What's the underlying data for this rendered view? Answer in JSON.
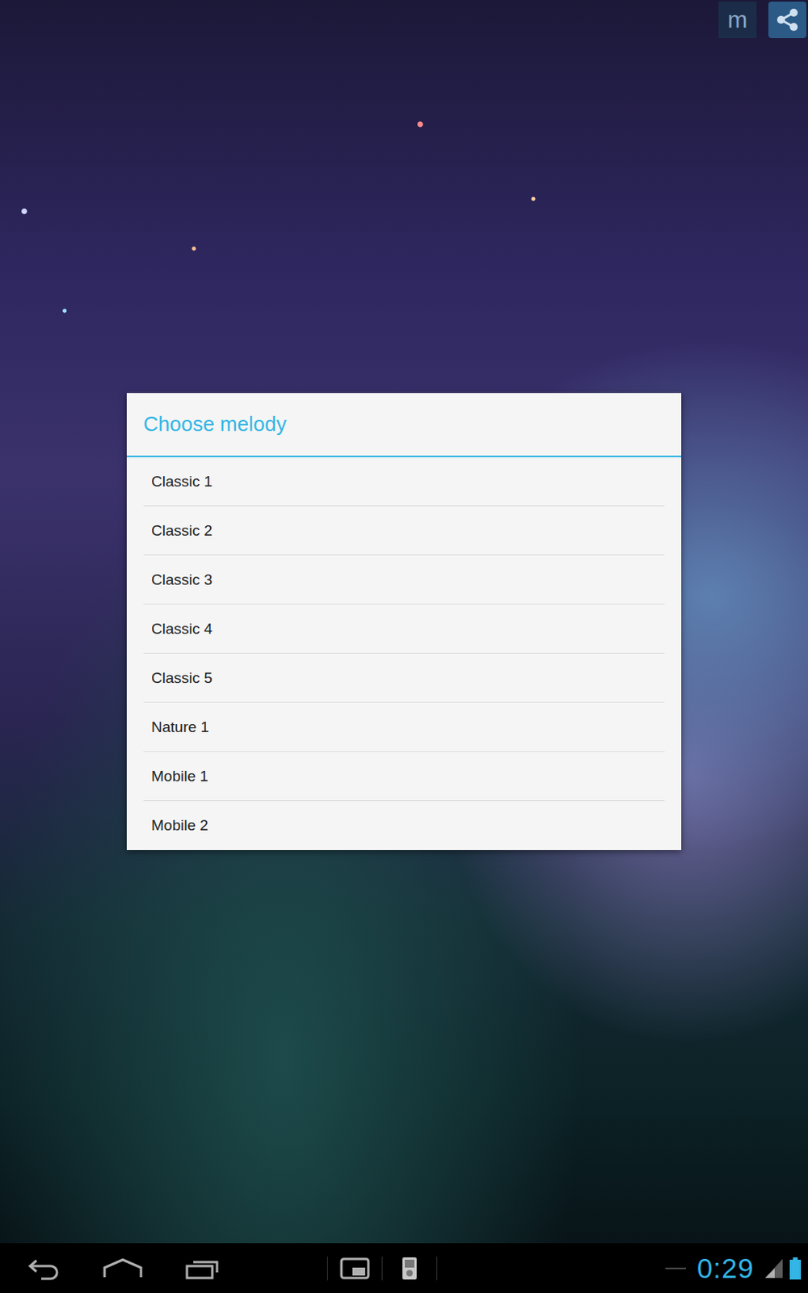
{
  "top_actions": {
    "menu_label": "m"
  },
  "dialog": {
    "title": "Choose melody",
    "items": [
      {
        "label": "Classic 1",
        "selected": false
      },
      {
        "label": "Classic 2",
        "selected": false
      },
      {
        "label": "Classic 3",
        "selected": false
      },
      {
        "label": "Classic 4",
        "selected": false
      },
      {
        "label": "Classic 5",
        "selected": false
      },
      {
        "label": "Nature 1",
        "selected": false
      },
      {
        "label": "Mobile 1",
        "selected": false
      },
      {
        "label": "Mobile 2",
        "selected": false
      }
    ]
  },
  "status_bar": {
    "time": "0:29"
  }
}
